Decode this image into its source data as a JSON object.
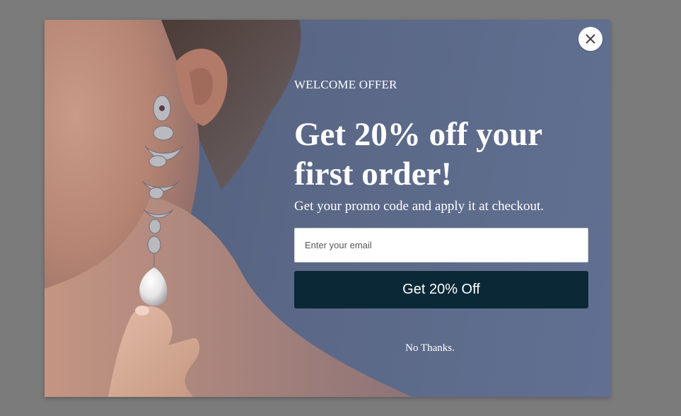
{
  "popup": {
    "eyebrow": "WELCOME OFFER",
    "headline": "Get 20% off your first order!",
    "subtext": "Get your promo code and apply it at checkout.",
    "email_placeholder": "Enter your email",
    "cta_label": "Get 20% Off",
    "decline_label": "No Thanks.",
    "close_icon": "close-icon"
  },
  "colors": {
    "backdrop": "#7b7b7b",
    "panel_blue": "#5a6786",
    "cta_background": "#0b2836",
    "text": "#ffffff"
  }
}
